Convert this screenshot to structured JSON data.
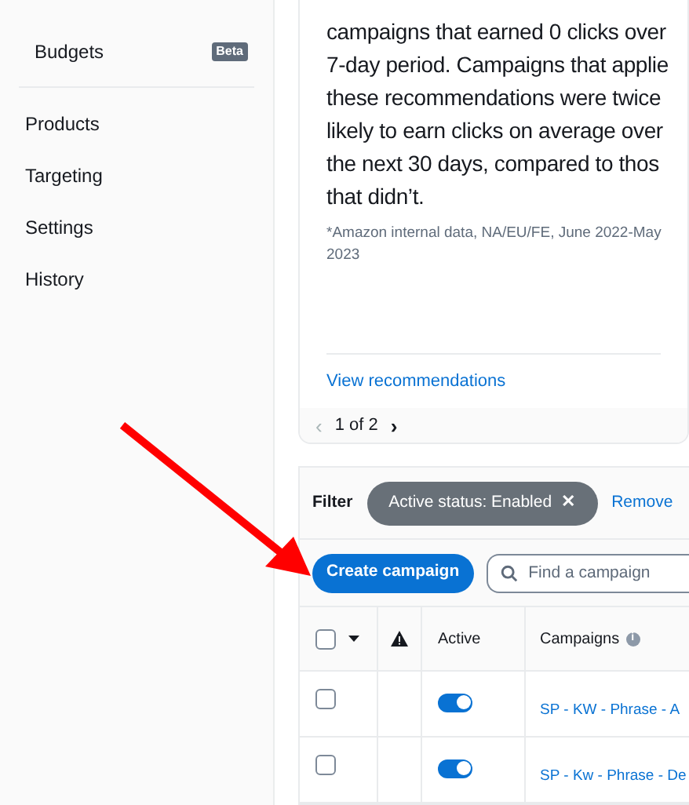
{
  "sidebar": {
    "top_items": [
      {
        "label": "Budgets",
        "badge": "Beta"
      }
    ],
    "items": [
      {
        "label": "Products"
      },
      {
        "label": "Targeting"
      },
      {
        "label": "Settings"
      },
      {
        "label": "History"
      }
    ]
  },
  "recommendation_card": {
    "lines": [
      "campaigns that earned 0 clicks over",
      "7-day period. Campaigns that applie",
      "these recommendations were twice",
      "likely to earn clicks on average over",
      "the next 30 days, compared to thos",
      "that didn’t."
    ],
    "footnote": "*Amazon internal data, NA/EU/FE, June 2022-May 2023",
    "link": "View recommendations",
    "pager": {
      "prev": "‹",
      "text": "1 of 2",
      "next": "›",
      "prev_disabled": true
    }
  },
  "campaigns": {
    "filter_label": "Filter",
    "filter_chip": {
      "label": "Active status: Enabled",
      "remove": "✕"
    },
    "remove_link": "Remove",
    "create_button": "Create campaign",
    "select_all_checked": false,
    "search": {
      "placeholder": "Find a campaign"
    },
    "columns": [
      {
        "label": "Active"
      },
      {
        "label": "Campaigns",
        "info": "i"
      }
    ],
    "rows": [
      {
        "checked": false,
        "active": true,
        "name": "SP - KW - Phrase - A"
      },
      {
        "checked": false,
        "active": true,
        "name": "SP - Kw - Phrase - De"
      }
    ]
  }
}
